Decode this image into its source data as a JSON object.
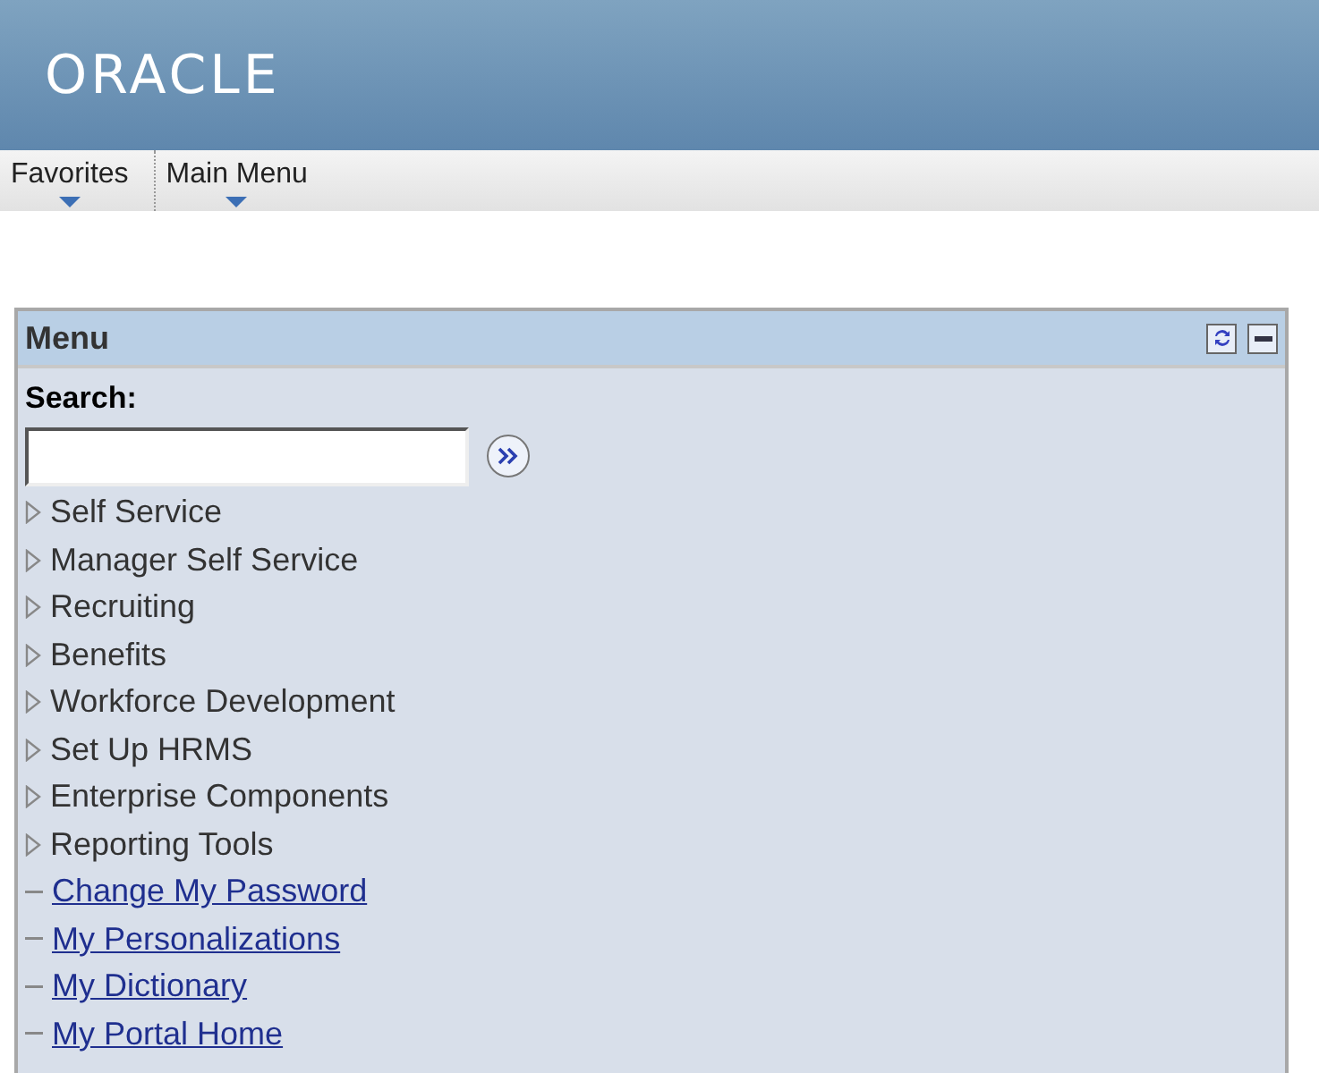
{
  "header": {
    "logo": "ORACLE"
  },
  "menubar": [
    {
      "label": "Favorites"
    },
    {
      "label": "Main Menu"
    }
  ],
  "panel": {
    "title": "Menu",
    "search_label": "Search:",
    "items": [
      {
        "kind": "folder",
        "label": "Self Service"
      },
      {
        "kind": "folder",
        "label": "Manager Self Service"
      },
      {
        "kind": "folder",
        "label": "Recruiting"
      },
      {
        "kind": "folder",
        "label": "Benefits"
      },
      {
        "kind": "folder",
        "label": "Workforce Development"
      },
      {
        "kind": "folder",
        "label": "Set Up HRMS"
      },
      {
        "kind": "folder",
        "label": "Enterprise Components"
      },
      {
        "kind": "folder",
        "label": "Reporting Tools"
      },
      {
        "kind": "link",
        "label": "Change My Password"
      },
      {
        "kind": "link",
        "label": "My Personalizations"
      },
      {
        "kind": "link",
        "label": "My Dictionary"
      },
      {
        "kind": "link",
        "label": "My Portal Home"
      }
    ]
  }
}
